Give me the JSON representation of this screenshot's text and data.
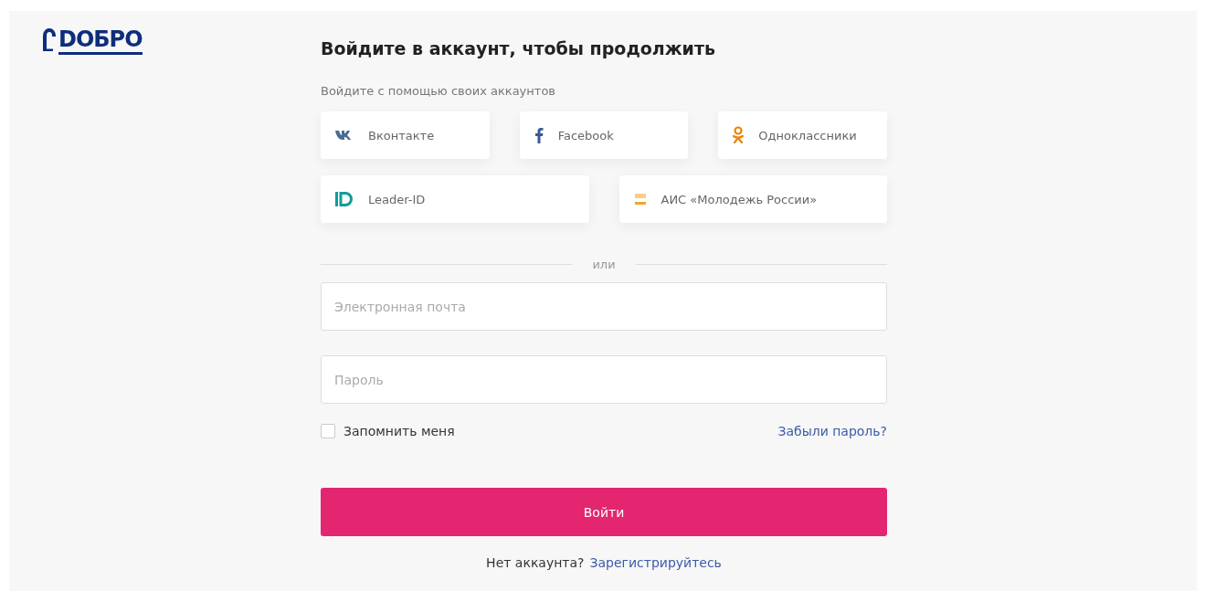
{
  "logo": {
    "text": "DОБРО"
  },
  "title": "Войдите в аккаунт, чтобы продолжить",
  "social_caption": "Войдите с помощью своих аккаунтов",
  "social_rows": [
    [
      {
        "kind": "vk",
        "label": "Вконтакте"
      },
      {
        "kind": "facebook",
        "label": "Facebook"
      },
      {
        "kind": "ok",
        "label": "Одноклассники"
      }
    ],
    [
      {
        "kind": "leaderid",
        "label": "Leader-ID"
      },
      {
        "kind": "rm",
        "label": "АИС «Молодежь России»"
      }
    ]
  ],
  "divider": "или",
  "fields": [
    {
      "placeholder": "Электронная почта"
    },
    {
      "placeholder": "Пароль"
    }
  ],
  "remember": {
    "label": "Запомнить меня",
    "checked": false
  },
  "forgot_link": "Забыли пароль?",
  "submit": "Войти",
  "signup": {
    "text": "Нет аккаунта?",
    "link": "Зарегистрируйтесь"
  }
}
